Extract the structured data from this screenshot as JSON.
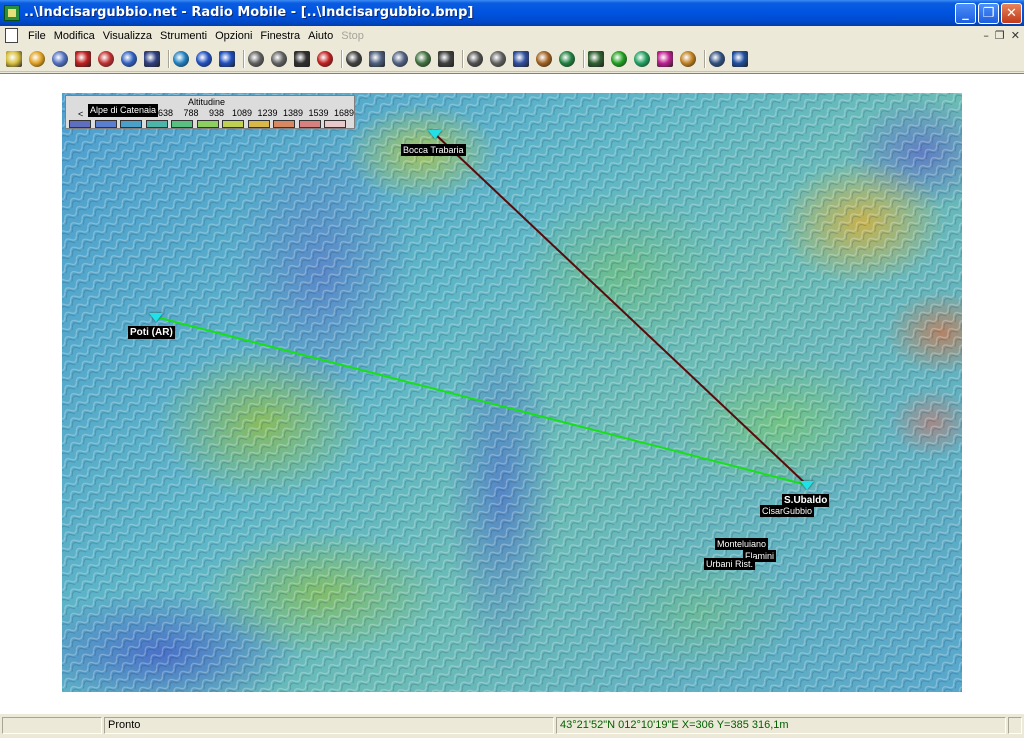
{
  "window": {
    "title": "..\\Indcisargubbio.net - Radio Mobile - [..\\Indcisargubbio.bmp]",
    "controls": {
      "minimize": "_",
      "maximize": "❐",
      "close": "✕"
    }
  },
  "menu": {
    "items": [
      "File",
      "Modifica",
      "Visualizza",
      "Strumenti",
      "Opzioni",
      "Finestra",
      "Aiuto",
      "Stop"
    ],
    "mdi_controls": {
      "minimize": "–",
      "restore": "❐",
      "close": "✕"
    }
  },
  "toolbar": {
    "icons": [
      "new-icon",
      "open-icon",
      "network-properties-icon",
      "unit-properties-icon",
      "link-icon",
      "map-properties-icon",
      "save-map-icon",
      "globe-icon",
      "back-arrow-icon",
      "forward-arrow-icon",
      "picture-icon",
      "copy-picture-icon",
      "save-picture-icon",
      "pdf-icon",
      "print-icon",
      "copy-icon",
      "paste-icon",
      "merge-icon",
      "elevation-grid-icon",
      "measure-icon",
      "grid-icon",
      "details-icon",
      "find-unit-icon",
      "fit-icon",
      "antenna-icon",
      "radio-coverage-icon",
      "polar-plot-icon",
      "cartesian-icon",
      "combine-icon",
      "gps-icon",
      "internet-icon"
    ]
  },
  "map": {
    "legend": {
      "title": "Altitudine",
      "place_label": "Alpe di Catenaia",
      "arrow": "<",
      "values": [
        "",
        "",
        "",
        "638",
        "788",
        "938",
        "1089",
        "1239",
        "1389",
        "1539",
        "1689"
      ],
      "colors": [
        "#5f6fc0",
        "#5a7fd0",
        "#4aa0c8",
        "#4cb4a8",
        "#58c080",
        "#8cd060",
        "#c0d050",
        "#d8b848",
        "#d88860",
        "#d88080",
        "#e8c8c8"
      ]
    },
    "sites": [
      {
        "name": "Bocca Trabaria",
        "bold": false
      },
      {
        "name": "Poti (AR)",
        "bold": true
      },
      {
        "name": "S.Ubaldo",
        "bold": true
      },
      {
        "name": "CisarGubbio",
        "bold": false
      },
      {
        "name": "Monteluiano",
        "bold": false
      },
      {
        "name": "Flamini",
        "bold": false
      },
      {
        "name": "Urbani Rist.",
        "bold": false
      }
    ],
    "links": [
      {
        "from": "Bocca Trabaria",
        "to": "S.Ubaldo",
        "color": "#5a0a0a"
      },
      {
        "from": "Poti (AR)",
        "to": "S.Ubaldo",
        "color": "#18e018"
      }
    ]
  },
  "status": {
    "pane1": "",
    "pane2": "Pronto",
    "coords": "43°21'52\"N 012°10'19\"E  X=306 Y=385 316,1m",
    "pane4": ""
  }
}
